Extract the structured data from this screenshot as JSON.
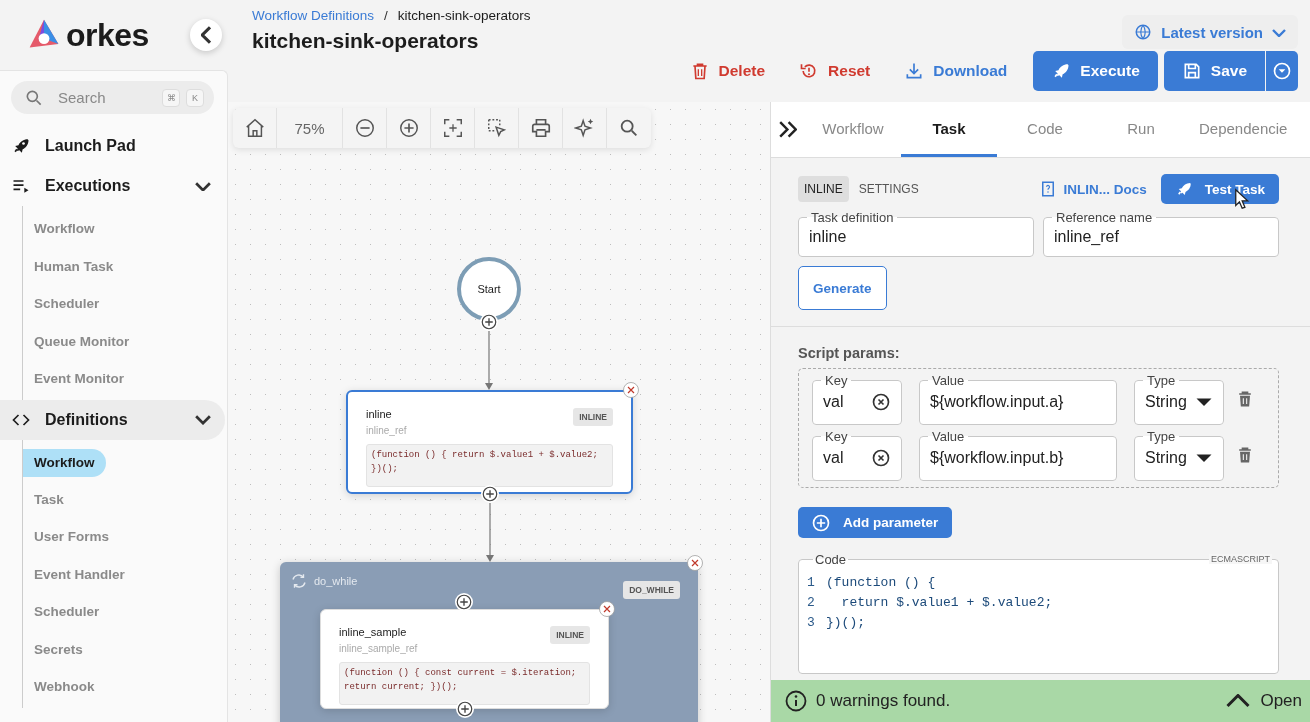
{
  "brand": {
    "name": "orkes"
  },
  "sidebar": {
    "search": {
      "placeholder": "Search",
      "keys": [
        "⌘",
        "K"
      ]
    },
    "items": [
      {
        "label": "Launch Pad",
        "kind": "link",
        "selected": false
      },
      {
        "label": "Executions",
        "kind": "group",
        "selected": false,
        "expanded": true,
        "children": [
          {
            "label": "Workflow",
            "selected": false
          },
          {
            "label": "Human Task",
            "selected": false
          },
          {
            "label": "Scheduler",
            "selected": false
          },
          {
            "label": "Queue Monitor",
            "selected": false
          },
          {
            "label": "Event Monitor",
            "selected": false
          }
        ]
      },
      {
        "label": "Definitions",
        "kind": "group",
        "selected": true,
        "expanded": true,
        "children": [
          {
            "label": "Workflow",
            "selected": true
          },
          {
            "label": "Task",
            "selected": false
          },
          {
            "label": "User Forms",
            "selected": false
          },
          {
            "label": "Event Handler",
            "selected": false
          },
          {
            "label": "Scheduler",
            "selected": false
          },
          {
            "label": "Secrets",
            "selected": false
          },
          {
            "label": "Webhook",
            "selected": false
          }
        ]
      }
    ]
  },
  "header": {
    "breadcrumb": [
      "Workflow Definitions",
      "kitchen-sink-operators"
    ],
    "separator": "/",
    "title": "kitchen-sink-operators",
    "version": "Latest version",
    "actions": [
      {
        "label": "Delete",
        "kind": "danger"
      },
      {
        "label": "Reset",
        "kind": "danger"
      },
      {
        "label": "Download",
        "kind": "link"
      },
      {
        "label": "Execute",
        "kind": "primary"
      },
      {
        "label": "Save",
        "kind": "split"
      }
    ]
  },
  "canvas": {
    "zoom": "75%",
    "nodes": [
      {
        "kind": "start",
        "label": "Start"
      },
      {
        "kind": "task",
        "name": "inline",
        "ref": "inline_ref",
        "type": "INLINE",
        "code": "(function () { return $.value1 + $.value2; })();",
        "selected": true
      },
      {
        "kind": "loop",
        "name": "do_while",
        "type": "DO_WHILE",
        "selected": false,
        "children": [
          {
            "kind": "task",
            "name": "inline_sample",
            "ref": "inline_sample_ref",
            "type": "INLINE",
            "code": "(function () { const current = $.iteration; return current; })();",
            "selected": false
          }
        ]
      }
    ]
  },
  "panel": {
    "tabs": [
      {
        "label": "Workflow",
        "selected": false
      },
      {
        "label": "Task",
        "selected": true
      },
      {
        "label": "Code",
        "selected": false
      },
      {
        "label": "Run",
        "selected": false
      },
      {
        "label": "Dependencie",
        "selected": false
      }
    ],
    "subtabs": [
      {
        "label": "INLINE",
        "selected": true
      },
      {
        "label": "SETTINGS",
        "selected": false
      }
    ],
    "docs_link": "INLIN... Docs",
    "test_button": "Test Task",
    "fields": [
      {
        "label": "Task definition",
        "value": "inline"
      },
      {
        "label": "Reference name",
        "value": "inline_ref"
      }
    ],
    "generate_button": "Generate",
    "script_params": {
      "title": "Script params:",
      "params": [
        {
          "key_label": "Key",
          "key": "val",
          "value_label": "Value",
          "value": "${workflow.input.a}",
          "type_label": "Type",
          "type": "String"
        },
        {
          "key_label": "Key",
          "key": "val",
          "value_label": "Value",
          "value": "${workflow.input.b}",
          "type_label": "Type",
          "type": "String"
        }
      ]
    },
    "add_button": "Add parameter",
    "code": {
      "label": "Code",
      "language": "ECMASCRIPT",
      "lines": [
        {
          "number": "1",
          "text": "(function () {"
        },
        {
          "number": "2",
          "text": "  return $.value1 + $.value2;"
        },
        {
          "number": "3",
          "text": "})();"
        }
      ]
    },
    "status": {
      "message": "0 warnings found.",
      "action": "Open"
    }
  }
}
